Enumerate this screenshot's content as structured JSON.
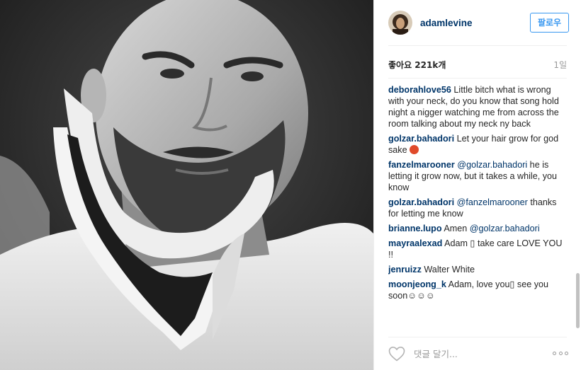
{
  "post": {
    "username": "adamlevine",
    "follow_label": "팔로우",
    "likes_text": "좋아요 221k개",
    "time_ago": "1일"
  },
  "comments": [
    {
      "user": "deborahlove56",
      "text": " Little bitch what is wrong with your neck, do you know that song hold night a nigger watching me from across the room talking about my neck ny back"
    },
    {
      "user": "golzar.bahadori",
      "text": " Let your hair grow for god sake "
    },
    {
      "user": "fanzelmarooner",
      "mention": "@golzar.bahadori",
      "text": " he is letting it grow now, but it takes a while, you know"
    },
    {
      "user": "golzar.bahadori",
      "mention": "@fanzelmarooner",
      "text": " thanks for letting me know"
    },
    {
      "user": "brianne.lupo",
      "text": " Amen ",
      "mention_after": "@golzar.bahadori"
    },
    {
      "user": "mayraalexad",
      "text": " Adam ▯ take care LOVE YOU !!"
    },
    {
      "user": "jenruizz",
      "text": " Walter White"
    },
    {
      "user": "moonjeong_k",
      "text": " Adam, love you▯ see you soon☺☺☺"
    }
  ],
  "footer": {
    "comment_placeholder": "댓글 달기..."
  },
  "icons": {
    "avatar": "avatar",
    "like": "heart-icon",
    "more": "more-options-icon",
    "emoji": "angry-face-emoji"
  },
  "colors": {
    "link": "#003569",
    "button": "#3897f0",
    "muted": "#999999"
  }
}
